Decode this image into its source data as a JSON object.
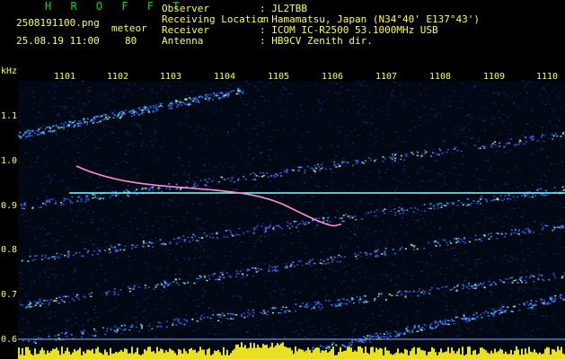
{
  "header": {
    "brand": "H R O F F T",
    "filename": "2508191100.png",
    "meteor_label": "meteor",
    "datetime": "25.08.19 11:00",
    "meteor_count": "80",
    "info": [
      {
        "label": "Observer",
        "value": ": JL2TBB"
      },
      {
        "label": "Receiving Location",
        "value": ": Hamamatsu, Japan (N34°40' E137°43')"
      },
      {
        "label": "Receiver",
        "value": ": ICOM IC-R2500 53.1000MHz USB"
      },
      {
        "label": "Antenna",
        "value": ": HB9CV Zenith dir."
      }
    ]
  },
  "time_axis": [
    "1101",
    "1102",
    "1103",
    "1104",
    "1105",
    "1106",
    "1107",
    "1108",
    "1109",
    "1110"
  ],
  "freq_axis": {
    "unit": "kHz",
    "ticks": [
      "1.1",
      "1.0",
      "0.9",
      "0.8",
      "0.7",
      "0.6"
    ]
  },
  "colors": {
    "text_green": "#00e000",
    "text_yellow": "#ffff40",
    "background": "#000000",
    "noise_blue": "#1a3aa0",
    "carrier": "#7fffff"
  }
}
